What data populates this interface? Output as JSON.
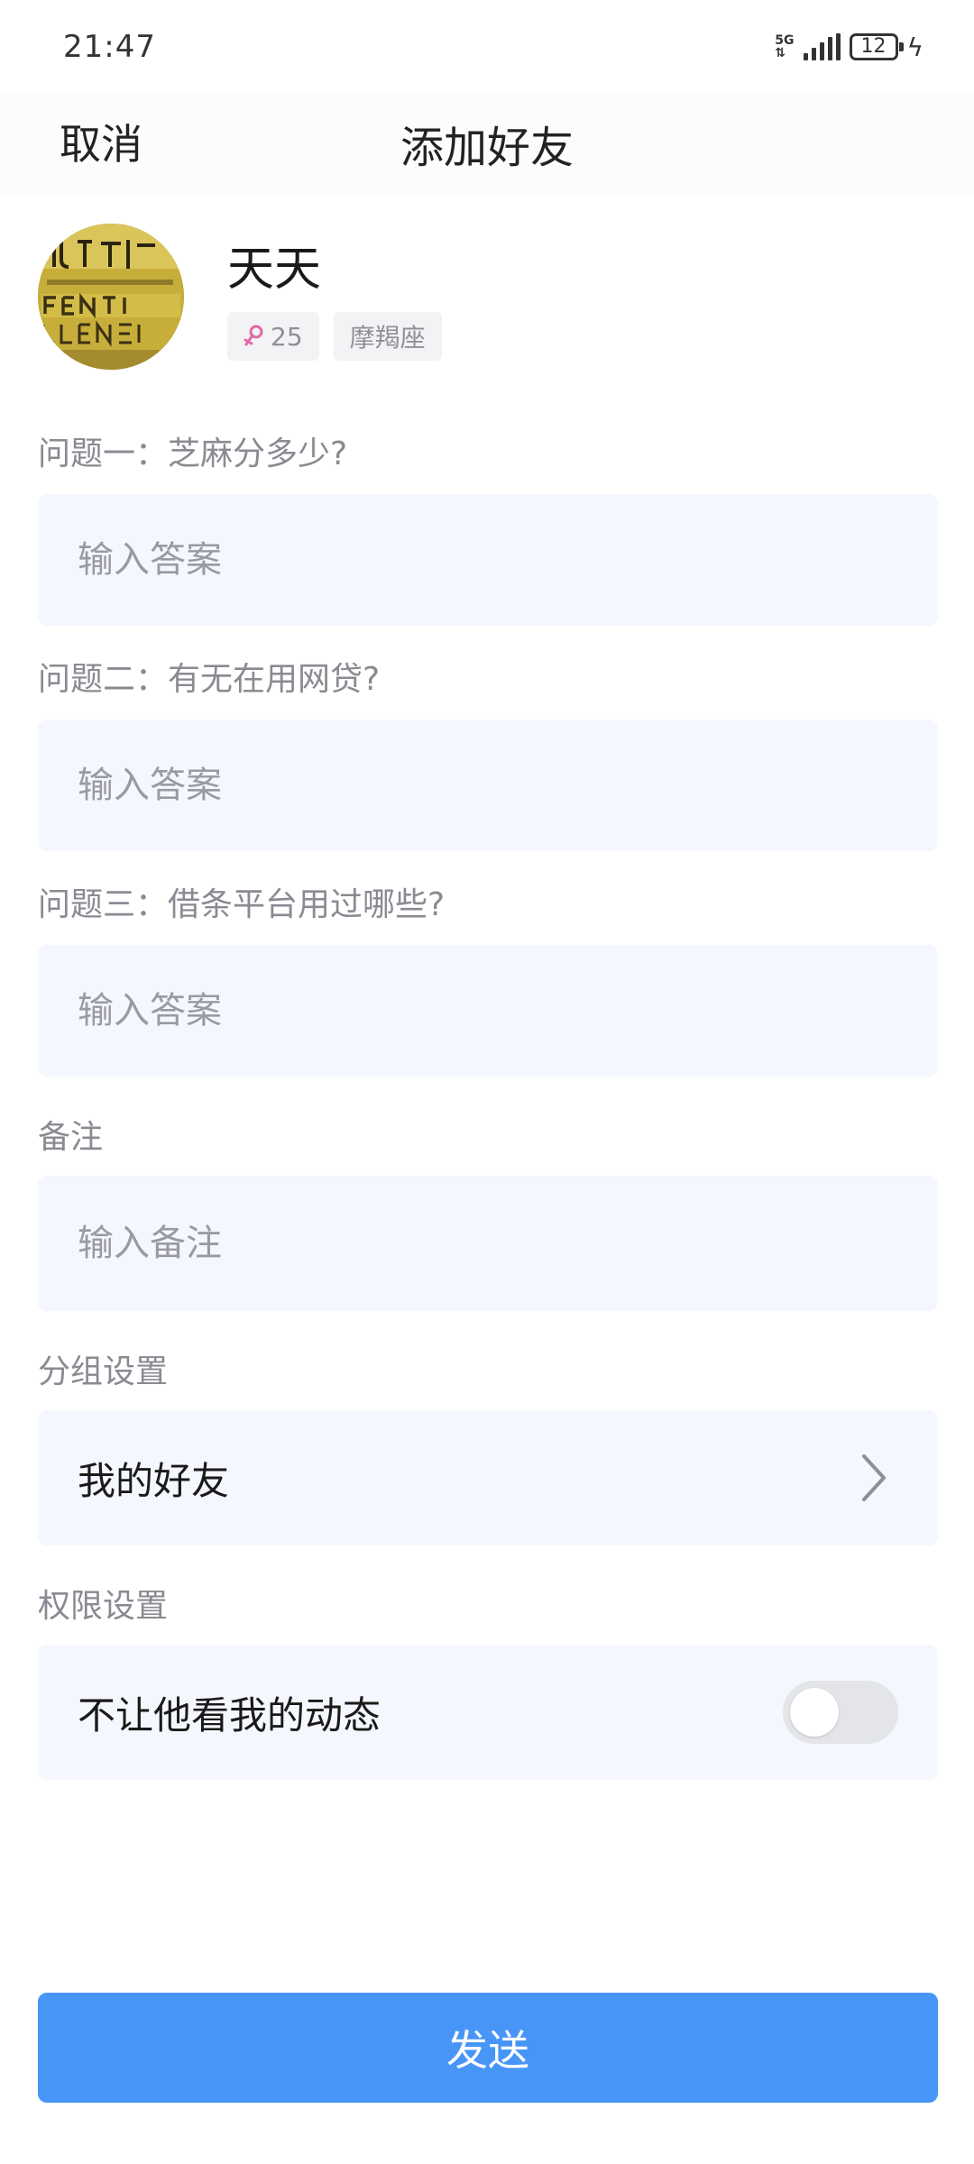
{
  "status_bar": {
    "time": "21:47",
    "network": "5G",
    "battery": "12"
  },
  "nav": {
    "cancel_label": "取消",
    "title": "添加好友"
  },
  "profile": {
    "name": "天天",
    "age": "25",
    "zodiac": "摩羯座"
  },
  "questions": [
    {
      "label": "问题一：芝麻分多少?",
      "placeholder": "输入答案"
    },
    {
      "label": "问题二：有无在用网贷?",
      "placeholder": "输入答案"
    },
    {
      "label": "问题三：借条平台用过哪些?",
      "placeholder": "输入答案"
    }
  ],
  "note": {
    "label": "备注",
    "placeholder": "输入备注"
  },
  "group": {
    "label": "分组设置",
    "value": "我的好友"
  },
  "permission": {
    "label": "权限设置",
    "option": "不让他看我的动态",
    "enabled": false
  },
  "send_label": "发送",
  "colors": {
    "primary": "#4795f7",
    "field_bg": "#f5f7fe",
    "label": "#8a8a92",
    "female_icon": "#e06aa8"
  }
}
